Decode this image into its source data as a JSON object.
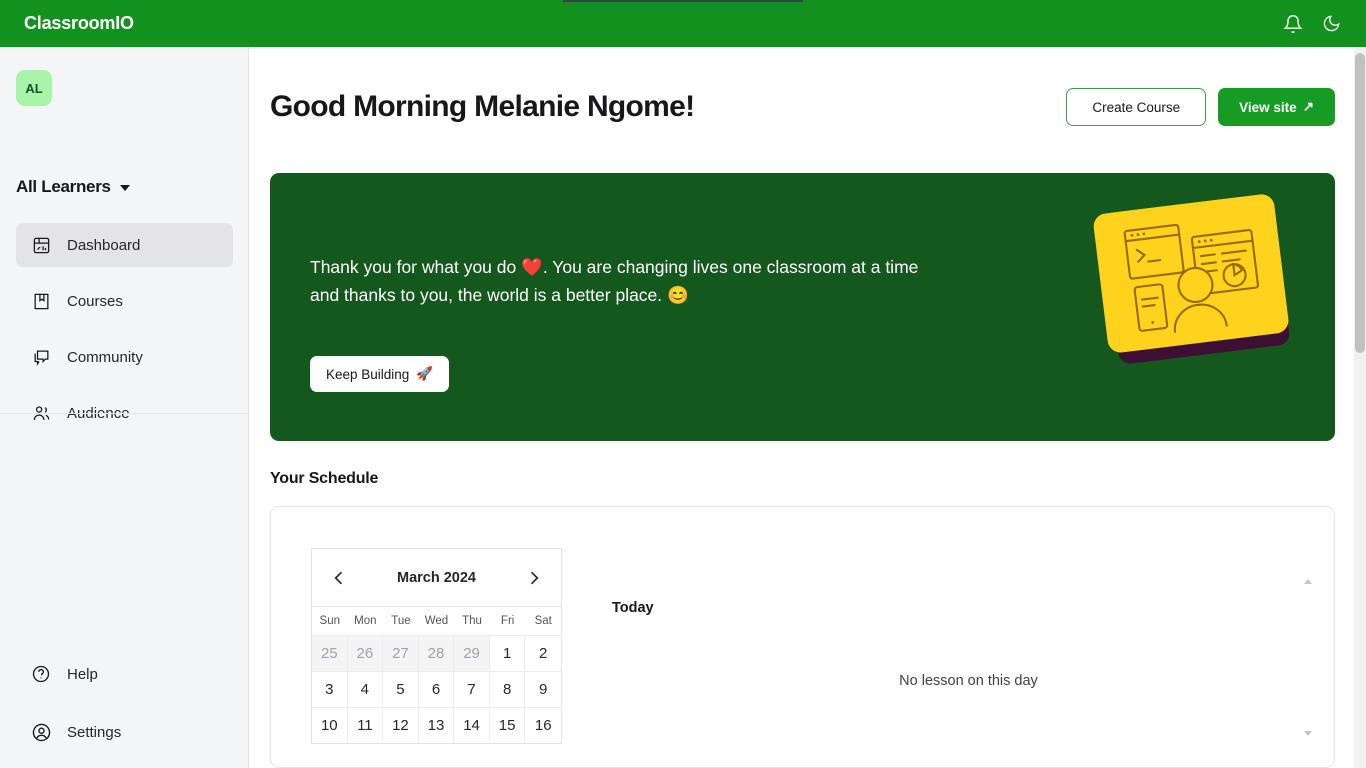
{
  "header": {
    "brand": "ClassroomIO",
    "icons": [
      {
        "name": "notification-bell-icon",
        "label": "Notifications"
      },
      {
        "name": "dark-mode-moon-icon",
        "label": "Dark mode"
      }
    ]
  },
  "sidebar": {
    "avatar_initials": "AL",
    "learner_selector": "All Learners",
    "nav_items": [
      {
        "label": "Dashboard",
        "icon": "dashboard-icon",
        "active": true
      },
      {
        "label": "Courses",
        "icon": "book-icon",
        "active": false
      },
      {
        "label": "Community",
        "icon": "chat-icon",
        "active": false
      },
      {
        "label": "Audience",
        "icon": "users-icon",
        "active": false
      }
    ],
    "bottom_items": [
      {
        "label": "Help",
        "icon": "help-circle-icon"
      },
      {
        "label": "Settings",
        "icon": "user-circle-icon"
      }
    ]
  },
  "main": {
    "page_title": "Good Morning Melanie Ngome!",
    "create_course_label": "Create Course",
    "view_site_label": "View site",
    "view_site_arrow": "↗",
    "banner": {
      "message": "Thank you for what you do ❤️. You are changing lives one classroom at a time and thanks to you, the world is a better place. 😊",
      "cta_label": "Keep Building",
      "cta_emoji": "🚀"
    },
    "schedule": {
      "section_title": "Your Schedule",
      "calendar": {
        "month_label": "March 2024",
        "prev_label": "Previous month",
        "next_label": "Next month",
        "weekdays": [
          "Sun",
          "Mon",
          "Tue",
          "Wed",
          "Thu",
          "Fri",
          "Sat"
        ],
        "days": [
          {
            "n": "25",
            "muted": true
          },
          {
            "n": "26",
            "muted": true
          },
          {
            "n": "27",
            "muted": true
          },
          {
            "n": "28",
            "muted": true
          },
          {
            "n": "29",
            "muted": true
          },
          {
            "n": "1",
            "muted": false
          },
          {
            "n": "2",
            "muted": false
          },
          {
            "n": "3",
            "muted": false
          },
          {
            "n": "4",
            "muted": false
          },
          {
            "n": "5",
            "muted": false
          },
          {
            "n": "6",
            "muted": false
          },
          {
            "n": "7",
            "muted": false
          },
          {
            "n": "8",
            "muted": false
          },
          {
            "n": "9",
            "muted": false
          },
          {
            "n": "10",
            "muted": false
          },
          {
            "n": "11",
            "muted": false
          },
          {
            "n": "12",
            "muted": false
          },
          {
            "n": "13",
            "muted": false
          },
          {
            "n": "14",
            "muted": false
          },
          {
            "n": "15",
            "muted": false
          },
          {
            "n": "16",
            "muted": false
          }
        ]
      },
      "today_label": "Today",
      "empty_state": "No lesson on this day"
    }
  },
  "colors": {
    "header_green": "#13911f",
    "banner_green": "#14581e",
    "primary_button_green": "#169b24",
    "outline_button_border": "#3e9c46",
    "avatar_mint": "#a7f3a7",
    "sidebar_bg": "#f4f5f7",
    "illustration_yellow": "#ffd21e",
    "illustration_plum": "#3d1033",
    "illustration_line": "#9a6b00"
  }
}
